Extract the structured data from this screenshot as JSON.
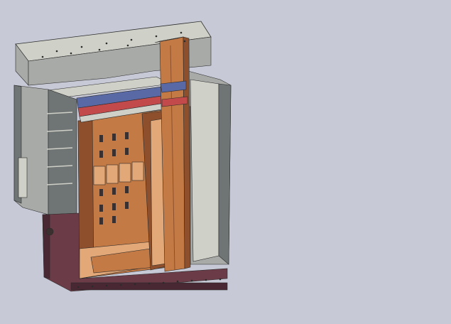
{
  "viewport": {
    "background": "#c7cad6",
    "model": {
      "colors": {
        "housing_gray": "#a8aaa8",
        "housing_light": "#cfd0c8",
        "housing_dark": "#6f7474",
        "copper": "#c47a45",
        "copper_light": "#e3a877",
        "copper_dark": "#8d4f2c",
        "base_maroon": "#6b3b48",
        "base_maroon_dark": "#4a2833",
        "blue_layer": "#5969a6",
        "red_layer": "#c24a4a",
        "hole": "#3a3030",
        "edge": "#2b2b2b"
      }
    }
  }
}
